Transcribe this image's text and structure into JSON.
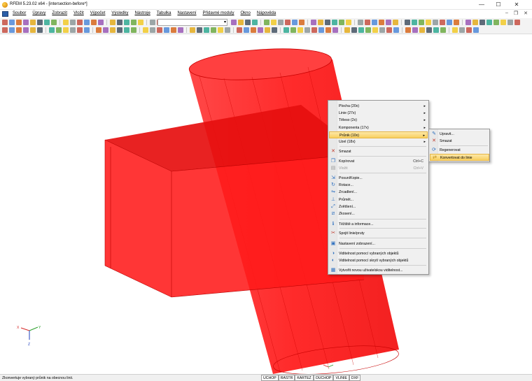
{
  "window": {
    "title": "RFEM 5.23.02 x64 - [intersection-before*]",
    "controls": {
      "minimize": "—",
      "maximize": "☐",
      "close": "✕"
    }
  },
  "menubar": {
    "items": [
      "Soubor",
      "Úpravy",
      "Zobrazit",
      "Vložit",
      "Výpočet",
      "Výsledky",
      "Nástroje",
      "Tabulka",
      "Nastavení",
      "Přídavné moduly",
      "Okno",
      "Nápověda"
    ],
    "mdi_controls": {
      "minimize": "–",
      "restore": "❐",
      "close": "✕"
    }
  },
  "context_menu": {
    "items": [
      {
        "label": "Plocha (20x)",
        "submenu": "▸"
      },
      {
        "label": "Linie (27x)",
        "submenu": "▸"
      },
      {
        "label": "Těleso (2x)",
        "submenu": "▸"
      },
      {
        "label": "Komponenta (17x)",
        "submenu": "▸"
      },
      {
        "label": "Průnik (10x)",
        "submenu": "▸"
      },
      {
        "label": "Uzel (18x)",
        "submenu": "▸"
      },
      {
        "label": "Smazat"
      },
      {
        "label": "Kopírovat",
        "shortcut": "Ctrl+C"
      },
      {
        "label": "Vložit",
        "shortcut": "Ctrl+V"
      },
      {
        "label": "Posun/Kopie..."
      },
      {
        "label": "Rotace..."
      },
      {
        "label": "Zrcadlení..."
      },
      {
        "label": "Průmět..."
      },
      {
        "label": "Zvětšení..."
      },
      {
        "label": "Zkosení..."
      },
      {
        "label": "Těžiště a informace..."
      },
      {
        "label": "Spojit linie/pruty"
      },
      {
        "label": "Nastavení zobrazení..."
      },
      {
        "label": "Viditelnost pomocí vybraných objektů"
      },
      {
        "label": "Viditelnost pomocí skrytí vybraných objektů"
      },
      {
        "label": "Vytvořit novou uživatelskou viditelnost..."
      }
    ]
  },
  "submenu": {
    "items": [
      {
        "label": "Upravit..."
      },
      {
        "label": "Smazat"
      },
      {
        "label": "Regenerovat"
      },
      {
        "label": "Konvertovat do linie"
      }
    ]
  },
  "axes": {
    "x": "X",
    "y": "Y",
    "z": "Z"
  },
  "statusbar": {
    "message": "Zkonvertuje vybraný průnik na obecnou linii.",
    "toggles": [
      "UCHOP",
      "RASTR",
      "KARTEZ",
      "OUCHOP",
      "VLINIE",
      "DXF"
    ]
  },
  "colors": {
    "solid_red": "#ff1a1a",
    "menu_highlight": "#f8cf60"
  }
}
